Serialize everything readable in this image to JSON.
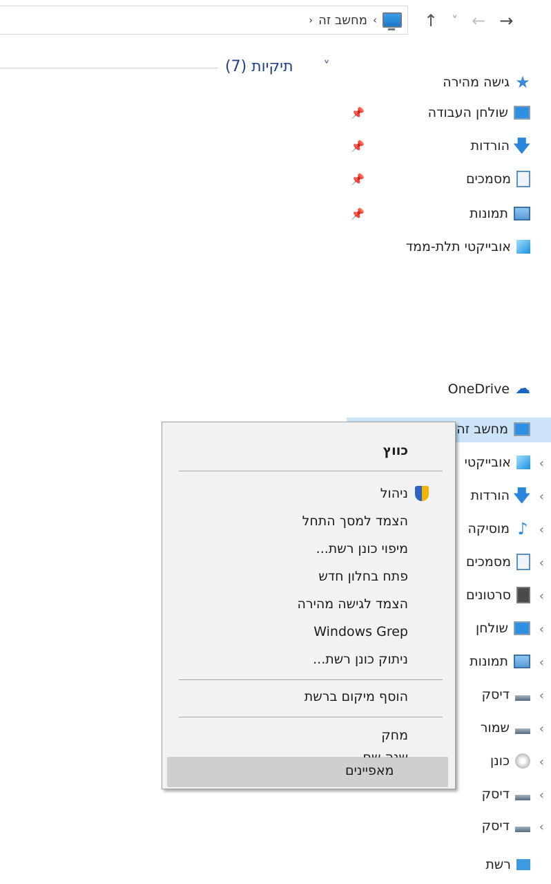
{
  "address_bar": {
    "crumbs": [
      "מחשב זה"
    ],
    "separator": "›",
    "overflow": "‹"
  },
  "nav_buttons": {
    "forward": "→",
    "back": "←",
    "recent": "˅",
    "up": "↑"
  },
  "content": {
    "folders_header": "תיקיות (7)",
    "chevron": "˅"
  },
  "nav_pane": {
    "quick_access": "גישה מהירה",
    "quick_items": [
      "שולחן העבודה",
      "הורדות",
      "מסמכים",
      "תמונות"
    ],
    "objects_3d": "אובייקטי תלת-ממד",
    "onedrive": "OneDrive",
    "this_pc": "מחשב זה",
    "pc_items": [
      "אובייקטי",
      "הורדות",
      "מוסיקה",
      "מסמכים",
      "סרטונים",
      "שולחן",
      "תמונות",
      "דיסק",
      "שמור",
      "כונן",
      "דיסק",
      "דיסק"
    ],
    "network": "רשת"
  },
  "context_menu": {
    "items": [
      "כווץ",
      "ניהול",
      "הצמד למסך התחל",
      "מיפוי כונן רשת...",
      "פתח בחלון חדש",
      "הצמד לגישה מהירה",
      "Windows Grep",
      "ניתוק כונן רשת...",
      "הוסף מיקום ברשת",
      "מחק",
      "שנה שם",
      "מאפיינים"
    ],
    "highlighted": "מאפיינים"
  },
  "colors": {
    "selection": "#cce4f7",
    "menu_bg": "#f2f2f2",
    "menu_highlight": "#cfcfcf",
    "folder_header": "#1e3f8a"
  }
}
